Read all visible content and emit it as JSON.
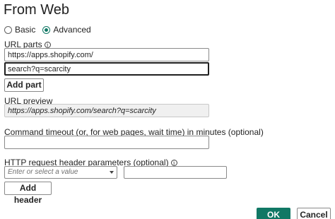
{
  "dialog": {
    "title": "From Web",
    "mode": {
      "basic_label": "Basic",
      "advanced_label": "Advanced",
      "selected": "Advanced"
    },
    "url_parts": {
      "label": "URL parts",
      "parts": [
        "https://apps.shopify.com/",
        "search?q=scarcity"
      ],
      "add_part_label": "Add part"
    },
    "url_preview": {
      "label": "URL preview",
      "value": "https://apps.shopify.com/search?q=scarcity"
    },
    "command_timeout": {
      "label": "Command timeout (or, for web pages, wait time) in minutes (optional)",
      "value": ""
    },
    "http_headers": {
      "label": "HTTP request header parameters (optional)",
      "select_placeholder": "Enter or select a value",
      "value": "",
      "add_header_label": "Add header"
    },
    "ok_label": "OK",
    "cancel_label": "Cancel",
    "accent_color": "#117865"
  }
}
